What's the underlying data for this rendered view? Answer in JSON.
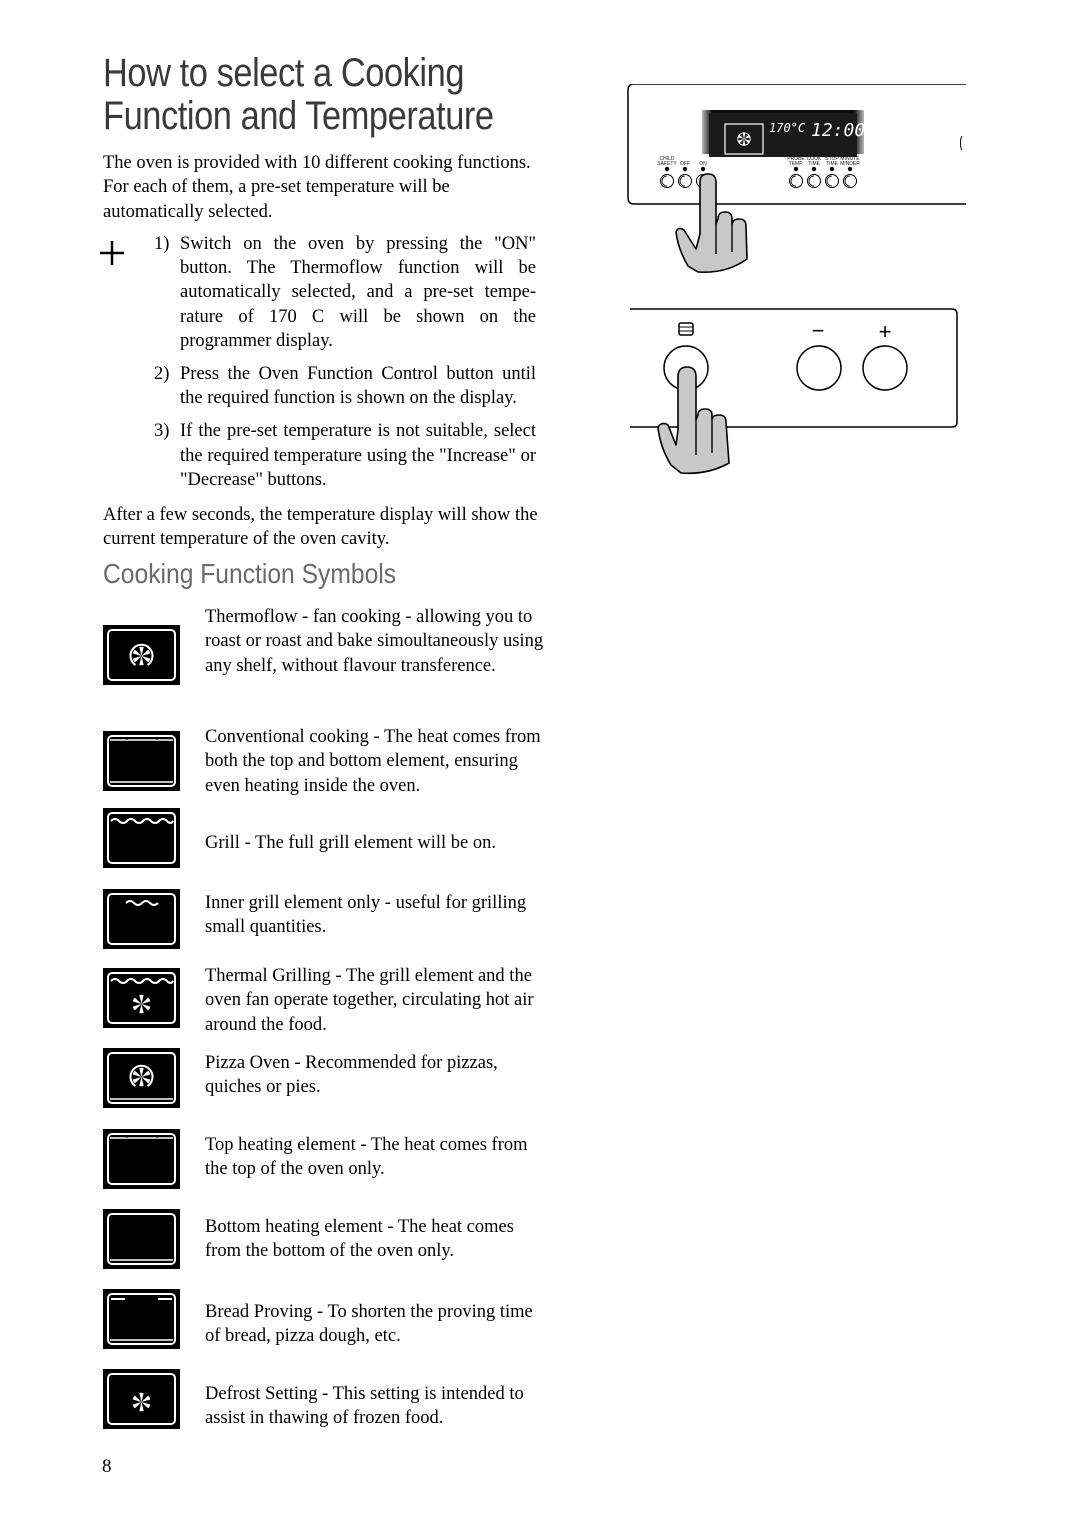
{
  "page": {
    "title_line1": "How to select a Cooking",
    "title_line2": "Function and Temperature",
    "intro": "The oven is provided with 10 different cooking functions. For each of them, a pre-set temperature will be automatically selected.",
    "steps": [
      {
        "num": "1)",
        "text": "Switch on the oven by pressing the \"ON\" button. The Thermoflow function will be automatically selected, and a pre-set tempe-rature of 170  C will be shown on the programmer display."
      },
      {
        "num": "2)",
        "text": "Press the Oven Function Control button until the required function is shown on the display."
      },
      {
        "num": "3)",
        "text": "If the pre-set temperature is not suitable, select the required temperature using the \"Increase\" or \"Decrease\" buttons."
      }
    ],
    "after_text": "After a few seconds, the temperature display will show the current temperature of the oven cavity.",
    "subheading": "Cooking Function Symbols",
    "page_number": "8"
  },
  "symbols": [
    {
      "icon": "thermoflow-fan-icon",
      "text": "Thermoflow - fan cooking - allowing you to roast or roast and bake simoultaneously using any shelf, without flavour transference."
    },
    {
      "icon": "conventional-cooking-icon",
      "text": "Conventional cooking - The heat comes from both the top and bottom element, ensuring even heating inside the oven."
    },
    {
      "icon": "full-grill-icon",
      "text": "Grill - The full grill element will be on."
    },
    {
      "icon": "inner-grill-icon",
      "text": "Inner grill element only - useful for grilling small quantities."
    },
    {
      "icon": "thermal-grilling-icon",
      "text": "Thermal Grilling -  The grill element and the oven fan operate together, circulating hot air around the food."
    },
    {
      "icon": "pizza-oven-icon",
      "text": "Pizza Oven - Recommended for pizzas, quiches or pies."
    },
    {
      "icon": "top-heating-icon",
      "text": "Top heating element - The heat comes from the top of the oven only."
    },
    {
      "icon": "bottom-heating-icon",
      "text": "Bottom heating element - The heat comes from the bottom of the oven only."
    },
    {
      "icon": "bread-proving-icon",
      "text": "Bread Proving - To shorten the proving time of bread, pizza dough, etc."
    },
    {
      "icon": "defrost-icon",
      "text": "Defrost Setting - This setting is intended to assist in thawing of frozen food."
    }
  ],
  "control_panel": {
    "display_temperature": "170°C",
    "display_time": "12:00",
    "left_buttons": [
      "CHILD SAFETY",
      "OFF",
      "ON"
    ],
    "right_buttons": [
      "PROBE TEMP.",
      "COOK TIME",
      "STOP TIME",
      "MINUTE MINDER"
    ],
    "function_button_symbol": "oven-function-icon",
    "decrease_label": "−",
    "increase_label": "+"
  }
}
